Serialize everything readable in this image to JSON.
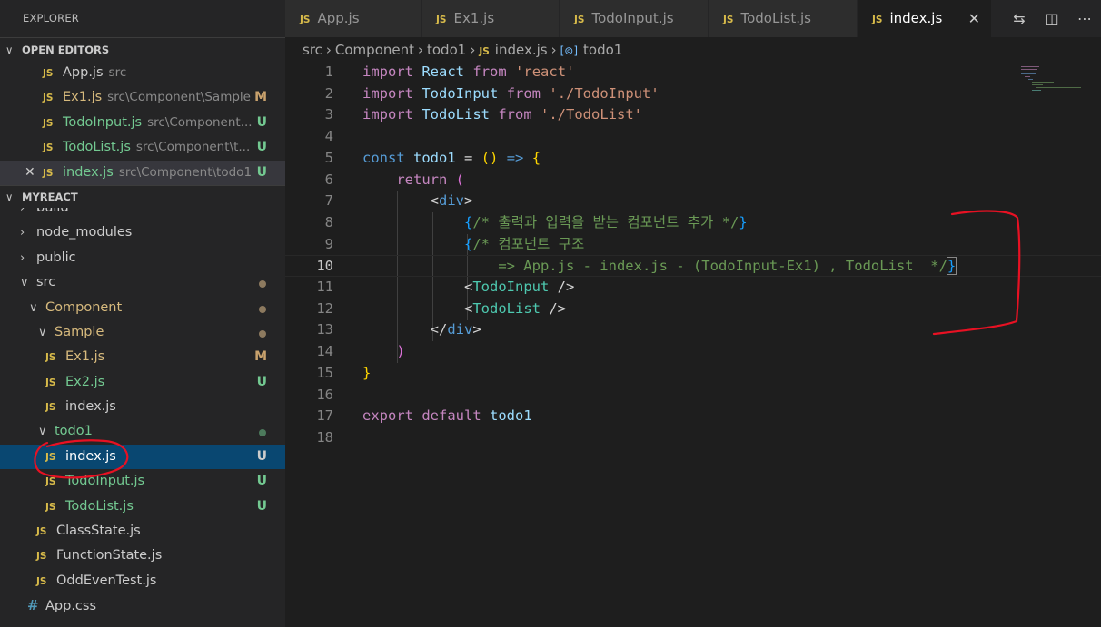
{
  "sidebar": {
    "title": "EXPLORER",
    "open_editors_header": "OPEN EDITORS",
    "workspace_header": "MYREACT",
    "open_editors": [
      {
        "icon": "JS",
        "name": "App.js",
        "path": "src",
        "badge": "",
        "style": "normal"
      },
      {
        "icon": "JS",
        "name": "Ex1.js",
        "path": "src\\Component\\Sample",
        "badge": "M",
        "style": "modified"
      },
      {
        "icon": "JS",
        "name": "TodoInput.js",
        "path": "src\\Component...",
        "badge": "U",
        "style": "untracked"
      },
      {
        "icon": "JS",
        "name": "TodoList.js",
        "path": "src\\Component\\t...",
        "badge": "U",
        "style": "untracked"
      },
      {
        "icon": "JS",
        "name": "index.js",
        "path": "src\\Component\\todo1",
        "badge": "U",
        "style": "untracked"
      }
    ],
    "tree": [
      {
        "label": "build",
        "indent": 0,
        "kind": "folder",
        "chevron": "›"
      },
      {
        "label": "node_modules",
        "indent": 0,
        "kind": "folder",
        "chevron": "›"
      },
      {
        "label": "public",
        "indent": 0,
        "kind": "folder",
        "chevron": "›"
      },
      {
        "label": "src",
        "indent": 0,
        "kind": "folder-open",
        "chevron": "∨",
        "dot": "brown"
      },
      {
        "label": "Component",
        "indent": 1,
        "kind": "folder-open",
        "chevron": "∨",
        "dot": "brown",
        "style": "modified"
      },
      {
        "label": "Sample",
        "indent": 2,
        "kind": "folder-open",
        "chevron": "∨",
        "dot": "brown",
        "style": "modified"
      },
      {
        "label": "Ex1.js",
        "indent": 3,
        "kind": "js",
        "badge": "M",
        "style": "modified"
      },
      {
        "label": "Ex2.js",
        "indent": 3,
        "kind": "js",
        "badge": "U",
        "style": "untracked"
      },
      {
        "label": "index.js",
        "indent": 3,
        "kind": "js"
      },
      {
        "label": "todo1",
        "indent": 2,
        "kind": "folder-open",
        "chevron": "∨",
        "dot": "green",
        "style": "untracked"
      },
      {
        "label": "index.js",
        "indent": 3,
        "kind": "js",
        "badge": "U",
        "selected": true
      },
      {
        "label": "TodoInput.js",
        "indent": 3,
        "kind": "js",
        "badge": "U",
        "style": "untracked"
      },
      {
        "label": "TodoList.js",
        "indent": 3,
        "kind": "js",
        "badge": "U",
        "style": "untracked"
      },
      {
        "label": "ClassState.js",
        "indent": 2,
        "kind": "js"
      },
      {
        "label": "FunctionState.js",
        "indent": 2,
        "kind": "js"
      },
      {
        "label": "OddEvenTest.js",
        "indent": 2,
        "kind": "js"
      },
      {
        "label": "App.css",
        "indent": 1,
        "kind": "css"
      }
    ]
  },
  "tabs": [
    {
      "label": "App.js",
      "active": false
    },
    {
      "label": "Ex1.js",
      "active": false
    },
    {
      "label": "TodoInput.js",
      "active": false
    },
    {
      "label": "TodoList.js",
      "active": false
    },
    {
      "label": "index.js",
      "active": true
    }
  ],
  "breadcrumb": {
    "parts": [
      "src",
      "Component",
      "todo1"
    ],
    "file": "index.js",
    "symbol": "todo1"
  },
  "editor": {
    "current_line": 10,
    "lines": [
      [
        [
          "kw",
          "import"
        ],
        [
          "pl",
          " "
        ],
        [
          "var",
          "React"
        ],
        [
          "pl",
          " "
        ],
        [
          "kw",
          "from"
        ],
        [
          "pl",
          " "
        ],
        [
          "str",
          "'react'"
        ]
      ],
      [
        [
          "kw",
          "import"
        ],
        [
          "pl",
          " "
        ],
        [
          "var",
          "TodoInput"
        ],
        [
          "pl",
          " "
        ],
        [
          "kw",
          "from"
        ],
        [
          "pl",
          " "
        ],
        [
          "str",
          "'./TodoInput'"
        ]
      ],
      [
        [
          "kw",
          "import"
        ],
        [
          "pl",
          " "
        ],
        [
          "var",
          "TodoList"
        ],
        [
          "pl",
          " "
        ],
        [
          "kw",
          "from"
        ],
        [
          "pl",
          " "
        ],
        [
          "str",
          "'./TodoList'"
        ]
      ],
      [],
      [
        [
          "kb",
          "const"
        ],
        [
          "pl",
          " "
        ],
        [
          "var",
          "todo1"
        ],
        [
          "pl",
          " = "
        ],
        [
          "br1",
          "()"
        ],
        [
          "pl",
          " "
        ],
        [
          "kb",
          "=>"
        ],
        [
          "pl",
          " "
        ],
        [
          "br1",
          "{"
        ]
      ],
      [
        [
          "pl",
          "    "
        ],
        [
          "kw",
          "return"
        ],
        [
          "pl",
          " "
        ],
        [
          "br2",
          "("
        ]
      ],
      [
        [
          "pl",
          "        "
        ],
        [
          "pl",
          "<"
        ],
        [
          "tag",
          "div"
        ],
        [
          "pl",
          ">"
        ]
      ],
      [
        [
          "pl",
          "            "
        ],
        [
          "br3",
          "{"
        ],
        [
          "cmt",
          "/* 출력과 입력을 받는 컴포넌트 추가 */"
        ],
        [
          "br3",
          "}"
        ]
      ],
      [
        [
          "pl",
          "            "
        ],
        [
          "br3",
          "{"
        ],
        [
          "cmt",
          "/* 컴포넌트 구조"
        ]
      ],
      [
        [
          "pl",
          "                "
        ],
        [
          "cmt",
          "=> App.js - index.js - (TodoInput-Ex1) , TodoList  */"
        ],
        [
          "br3",
          "}"
        ]
      ],
      [
        [
          "pl",
          "            <"
        ],
        [
          "comp",
          "TodoInput"
        ],
        [
          "pl",
          " />"
        ]
      ],
      [
        [
          "pl",
          "            <"
        ],
        [
          "comp",
          "TodoList"
        ],
        [
          "pl",
          " />"
        ]
      ],
      [
        [
          "pl",
          "        </"
        ],
        [
          "tag",
          "div"
        ],
        [
          "pl",
          ">"
        ]
      ],
      [
        [
          "pl",
          "    "
        ],
        [
          "br2",
          ")"
        ]
      ],
      [
        [
          "br1",
          "}"
        ]
      ],
      [],
      [
        [
          "kw",
          "export"
        ],
        [
          "pl",
          " "
        ],
        [
          "kw",
          "default"
        ],
        [
          "pl",
          " "
        ],
        [
          "var",
          "todo1"
        ]
      ],
      []
    ]
  },
  "colors": {
    "annotation": "#e81123",
    "selection": "#094771",
    "modified": "#c9a26d",
    "untracked": "#73c991"
  }
}
